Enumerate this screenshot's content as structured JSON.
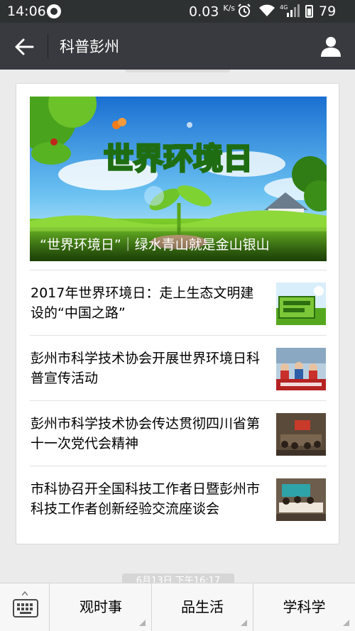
{
  "status_bar": {
    "time": "14:06",
    "speed": "0.03",
    "speed_unit": "K/s",
    "network": "4G",
    "battery": "79"
  },
  "header": {
    "title": "科普彭州"
  },
  "hero": {
    "image_text": "世界环境日",
    "caption": "“世界环境日”｜绿水青山就是金山银山"
  },
  "articles": [
    {
      "title": "2017年世界环境日：走上生态文明建设的“中国之路”"
    },
    {
      "title": "彭州市科学技术协会开展世界环境日科普宣传活动"
    },
    {
      "title": "彭州市科学技术协会传达贯彻四川省第十一次党代会精神"
    },
    {
      "title": "市科协召开全国科技工作者日暨彭州市科技工作者创新经验交流座谈会"
    }
  ],
  "timestamp": "6月13日 下午16:17",
  "bottom_menu": {
    "items": [
      {
        "label": "观时事"
      },
      {
        "label": "品生活"
      },
      {
        "label": "学科学"
      }
    ]
  }
}
